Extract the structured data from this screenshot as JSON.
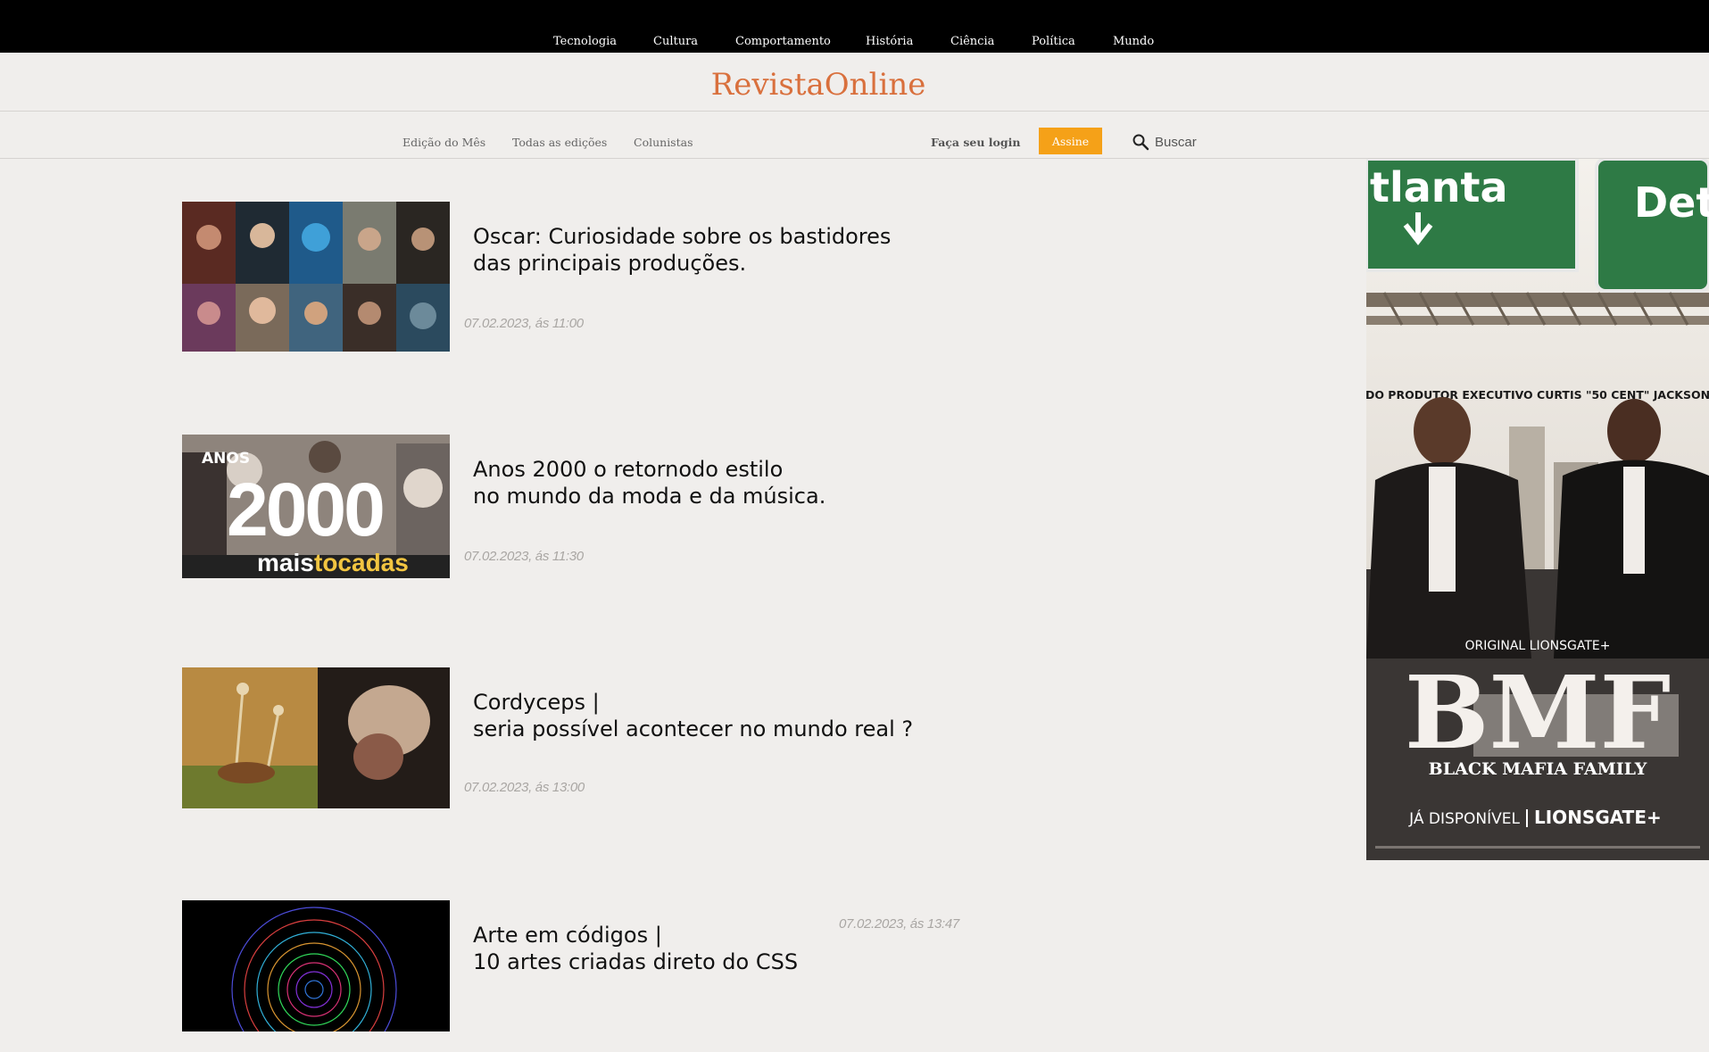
{
  "topnav": [
    "Tecnologia",
    "Cultura",
    "Comportamento",
    "História",
    "Ciência",
    "Política",
    "Mundo"
  ],
  "logo": "RevistaOnline",
  "subnav": {
    "links": [
      "Edição do Mês",
      "Todas as edições",
      "Colunistas"
    ],
    "login": "Faça seu login",
    "subscribe": "Assine",
    "search_placeholder": "Buscar"
  },
  "articles": [
    {
      "title_lines": [
        "Oscar: Curiosidade sobre os bastidores",
        "das principais produções."
      ],
      "date": "07.02.2023, ás 11:00"
    },
    {
      "title_lines": [
        "Anos 2000 o retornodo estilo",
        "no mundo da moda e da música."
      ],
      "date": "07.02.2023, ás 11:30",
      "thumb_text": {
        "top": "ANOS",
        "big": "2000",
        "bottom_a": "mais",
        "bottom_b": "tocadas"
      }
    },
    {
      "title_lines": [
        "Cordyceps |",
        "seria possível acontecer no mundo real ?"
      ],
      "date": "07.02.2023, ás 13:00"
    },
    {
      "title_lines": [
        "Arte em códigos |",
        "10 artes criadas direto do CSS"
      ],
      "date": "07.02.2023, ás 13:47"
    }
  ],
  "ad": {
    "sign_left": "tlanta",
    "sign_right": "Det",
    "tagline": "DO PRODUTOR EXECUTIVO CURTIS \"50 CENT\" JACKSON",
    "original": "ORIGINAL LIONSGATE+",
    "brand": "BMF",
    "subtitle": "BLACK MAFIA FAMILY",
    "available": "JÁ DISPONÍVEL",
    "network": "LIONSGATE+",
    "colors": {
      "sign_green": "#2e7a45",
      "accent": "#f5a118",
      "logo": "#d9703d"
    }
  }
}
